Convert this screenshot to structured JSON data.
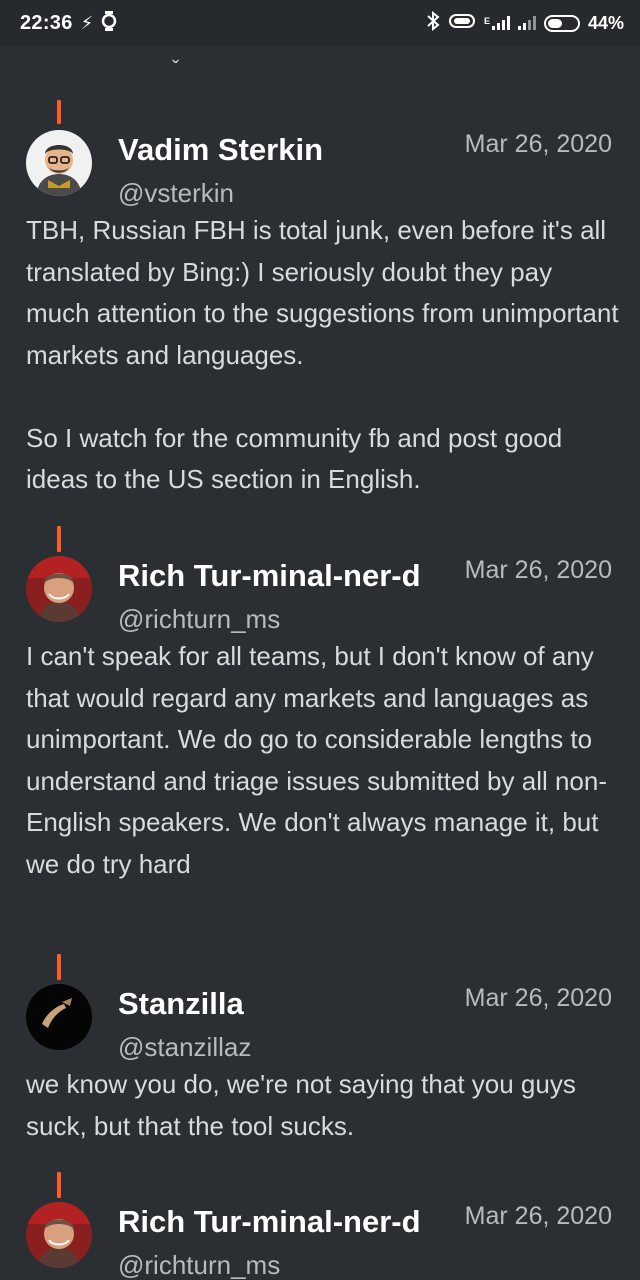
{
  "status_bar": {
    "time": "22:36",
    "network_label": "E",
    "battery_percent": "44%",
    "icons": [
      "charging-icon",
      "watch-icon",
      "bluetooth-icon",
      "vibrate-icon",
      "signal-icon",
      "signal-icon",
      "battery-icon"
    ]
  },
  "posts": [
    {
      "name": "Vadim Sterkin",
      "handle": "@vsterkin",
      "date": "Mar 26, 2020",
      "avatar": "avatar-vadim",
      "paragraphs": [
        "TBH, Russian FBH is total junk, even before it's all translated by Bing:) I seriously doubt they pay much attention to the suggestions from unimportant markets and languages.",
        "So I watch for the community fb and post good ideas to the US section in English."
      ]
    },
    {
      "name": "Rich Tur-minal-ner-d",
      "handle": "@richturn_ms",
      "date": "Mar 26, 2020",
      "avatar": "avatar-rich",
      "paragraphs": [
        "I can't speak for all teams, but I don't know of any that would regard any markets and languages as unimportant. We do go to considerable lengths to understand and triage issues submitted by all non-English speakers. We don't always manage it, but we do try hard"
      ]
    },
    {
      "name": "Stanzilla",
      "handle": "@stanzillaz",
      "date": "Mar 26, 2020",
      "avatar": "avatar-stanzilla",
      "paragraphs": [
        "we know you do, we're not saying that you guys suck, but that the tool sucks."
      ]
    },
    {
      "name": "Rich Tur-minal-ner-d",
      "handle": "@richturn_ms",
      "date": "Mar 26, 2020",
      "avatar": "avatar-rich",
      "paragraphs": []
    }
  ],
  "colors": {
    "background": "#2b2f33",
    "status_bar": "#26292d",
    "thread_line": "#ff5a27",
    "secondary_text": "#b6bbc0"
  }
}
